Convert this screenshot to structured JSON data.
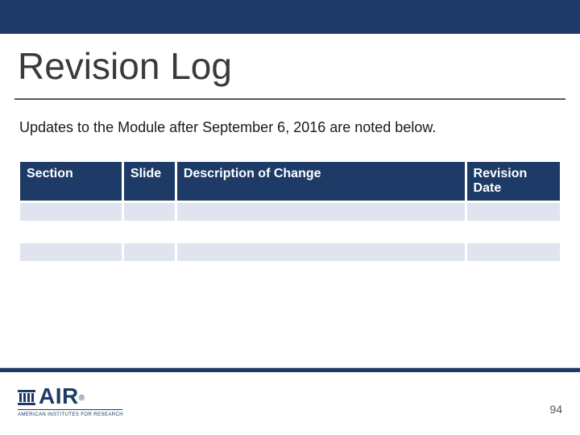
{
  "title": "Revision Log",
  "subtitle": "Updates to the Module after September 6, 2016 are noted below.",
  "table": {
    "headers": {
      "section": "Section",
      "slide": "Slide",
      "description": "Description of Change",
      "revision_date": "Revision Date"
    },
    "rows": [
      {
        "section": "",
        "slide": "",
        "description": "",
        "revision_date": ""
      },
      {
        "section": "",
        "slide": "",
        "description": "",
        "revision_date": ""
      },
      {
        "section": "",
        "slide": "",
        "description": "",
        "revision_date": ""
      }
    ]
  },
  "footer": {
    "logo_text": "AIR",
    "logo_subtext": "AMERICAN INSTITUTES FOR RESEARCH",
    "page_number": "94"
  }
}
